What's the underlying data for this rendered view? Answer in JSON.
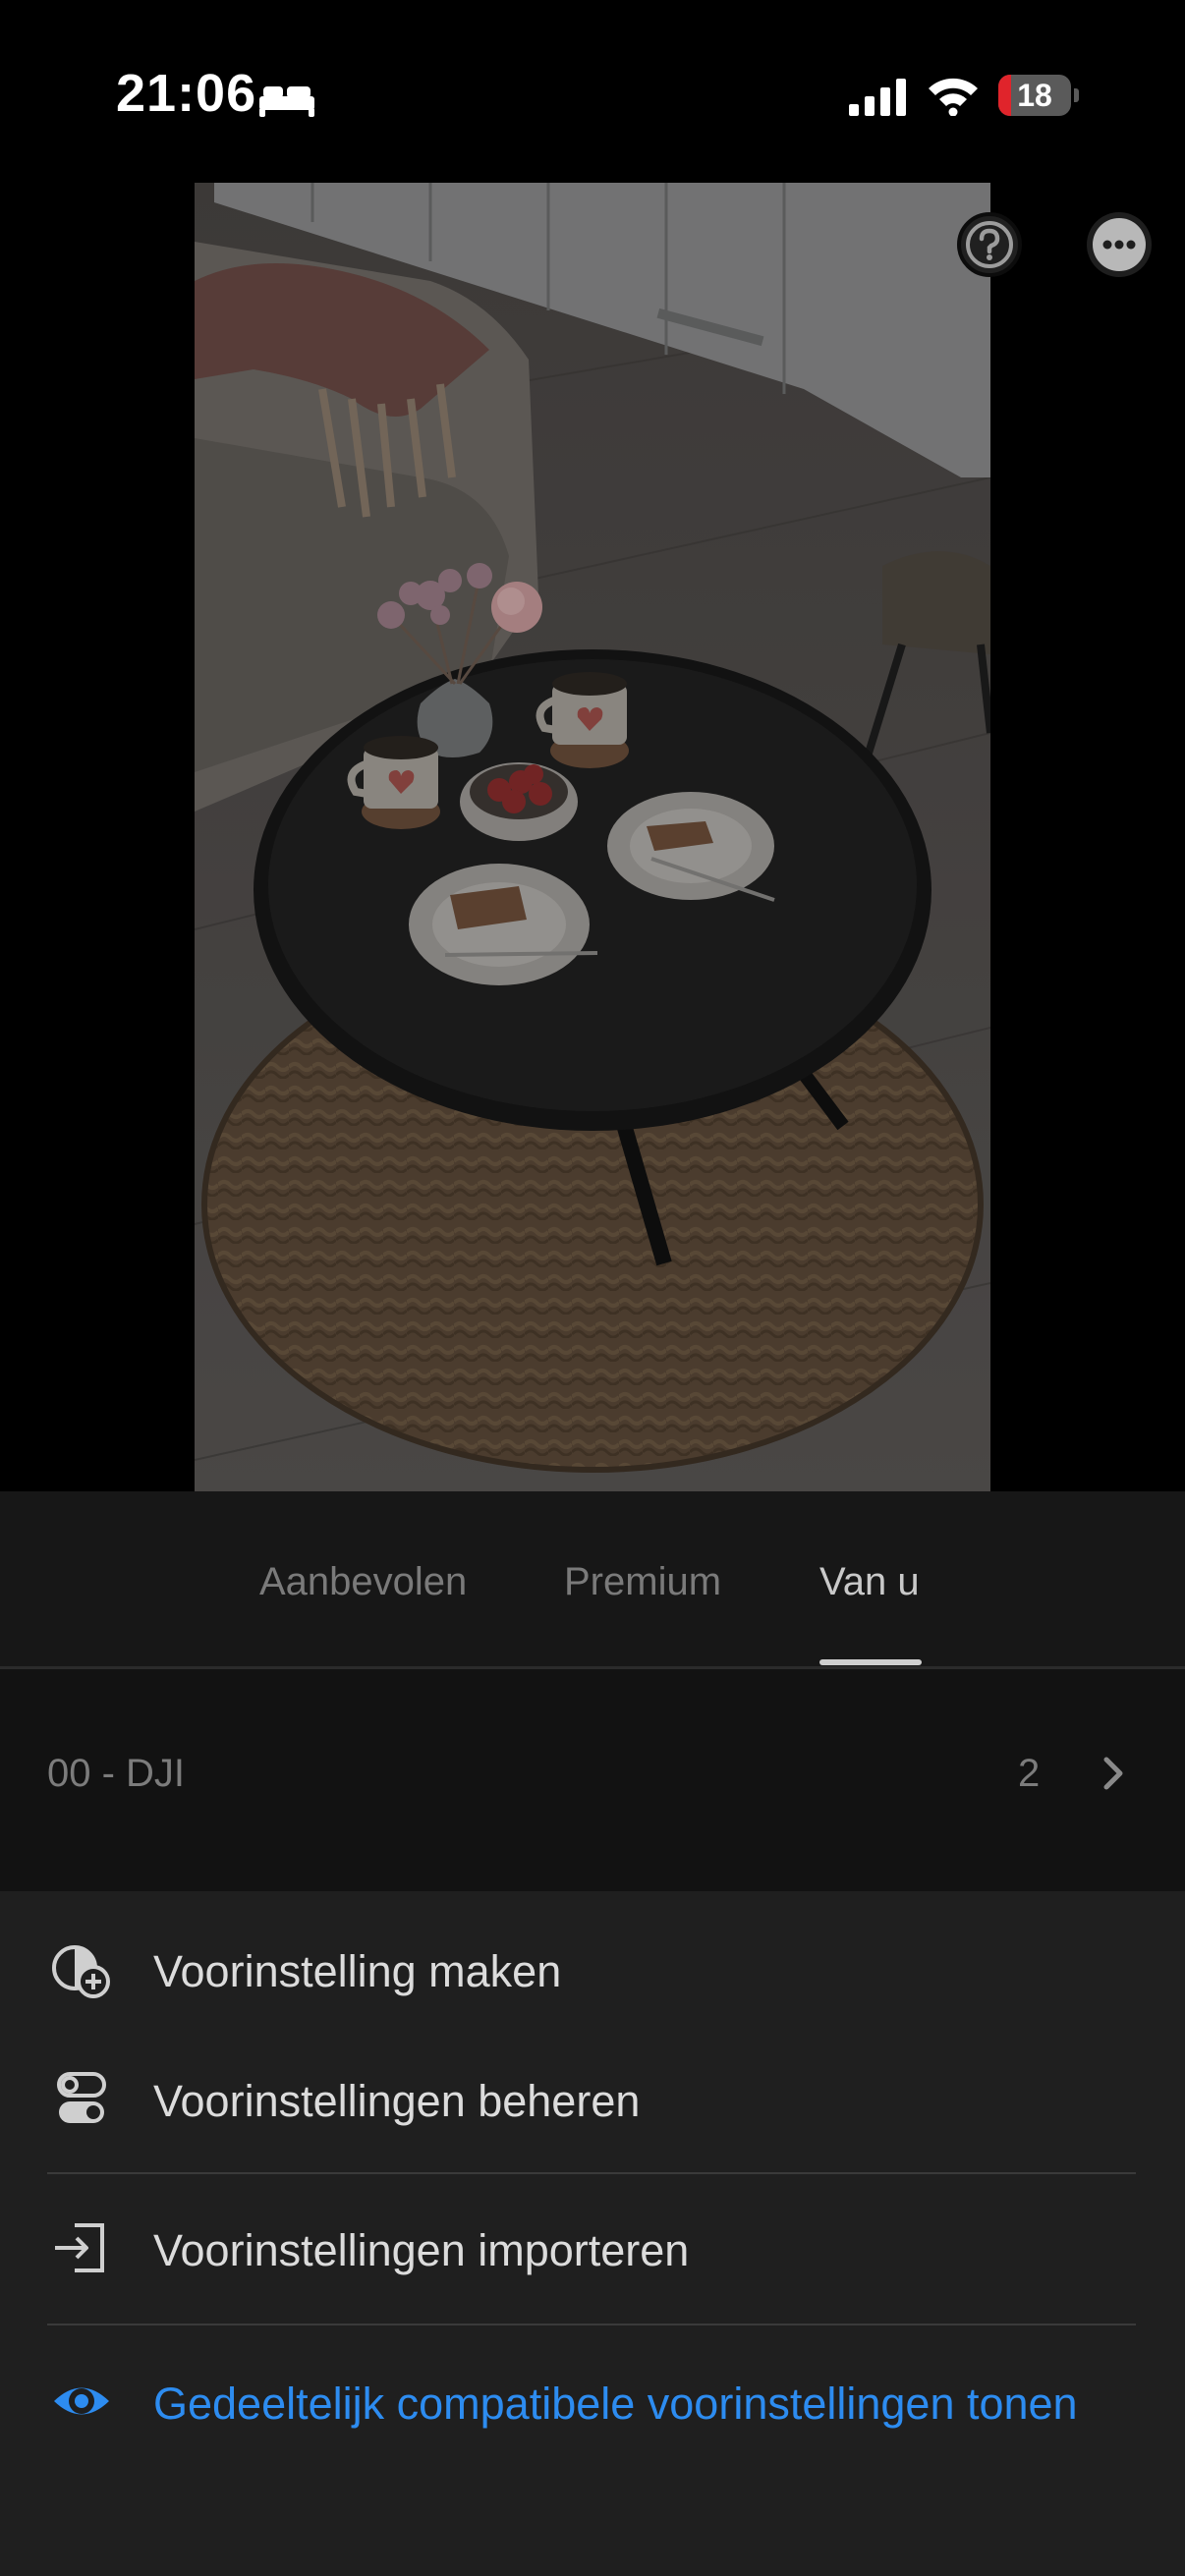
{
  "status_bar": {
    "time": "21:06",
    "battery_level": "18",
    "battery_color": "#e0242b",
    "icons": [
      "bed-icon",
      "cellular-signal-icon",
      "wifi-icon",
      "battery-icon"
    ]
  },
  "photo": {
    "icons": [
      "help-icon",
      "more-icon"
    ]
  },
  "tabs": [
    {
      "label": "Aanbevolen",
      "active": false
    },
    {
      "label": "Premium",
      "active": false
    },
    {
      "label": "Van u",
      "active": true
    }
  ],
  "preset_group": {
    "name": "00 - DJI",
    "count": "2",
    "icon": "chevron-right-icon"
  },
  "menu": {
    "items": [
      {
        "label": "Voorinstelling maken",
        "icon": "create-preset-icon"
      },
      {
        "label": "Voorinstellingen beheren",
        "icon": "manage-presets-icon"
      },
      {
        "label": "Voorinstellingen importeren",
        "icon": "import-icon"
      },
      {
        "label": "Gedeeltelijk compatibele voorinstellingen tonen",
        "icon": "eye-icon",
        "color": "#2d8cf0"
      }
    ]
  }
}
